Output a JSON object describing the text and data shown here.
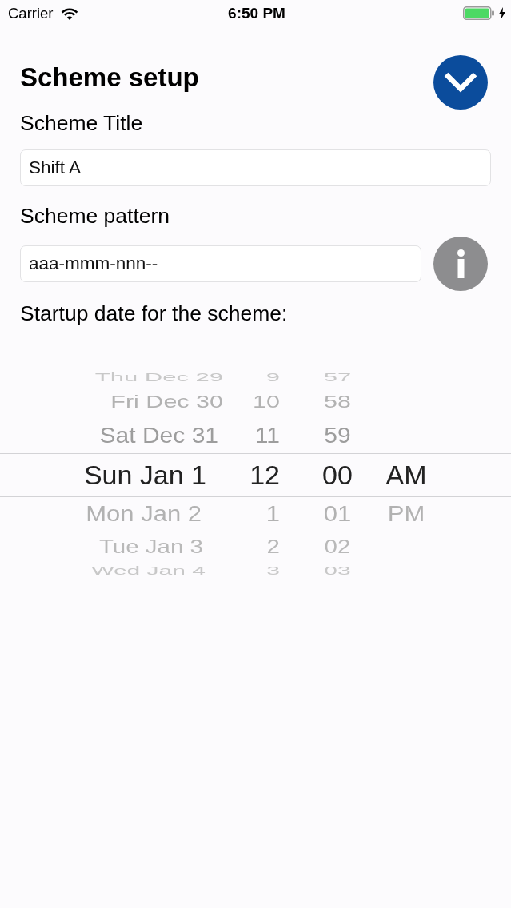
{
  "status_bar": {
    "carrier": "Carrier",
    "time": "6:50 PM",
    "charging": true
  },
  "header": {
    "title": "Scheme setup"
  },
  "fields": [
    {
      "kind": "plain",
      "label": "Scheme Title",
      "value": "Shift A"
    },
    {
      "kind": "info",
      "label": "Scheme pattern",
      "value": "aaa-mmm-nnn--"
    }
  ],
  "date_picker": {
    "label": "Startup date for the scheme:",
    "columns": [
      {
        "kind": "date",
        "items": [
          {
            "label": "Thu Dec 29",
            "selected": false
          },
          {
            "label": "Fri Dec 30",
            "selected": false
          },
          {
            "label": "Sat Dec 31",
            "selected": false
          },
          {
            "label": "Sun Jan 1",
            "selected": true
          },
          {
            "label": "Mon Jan 2",
            "selected": false
          },
          {
            "label": "Tue Jan 3",
            "selected": false
          },
          {
            "label": "Wed Jan 4",
            "selected": false
          }
        ]
      },
      {
        "kind": "hour",
        "items": [
          {
            "label": "9",
            "selected": false
          },
          {
            "label": "10",
            "selected": false
          },
          {
            "label": "11",
            "selected": false
          },
          {
            "label": "12",
            "selected": true
          },
          {
            "label": "1",
            "selected": false
          },
          {
            "label": "2",
            "selected": false
          },
          {
            "label": "3",
            "selected": false
          }
        ]
      },
      {
        "kind": "minute",
        "items": [
          {
            "label": "57",
            "selected": false
          },
          {
            "label": "58",
            "selected": false
          },
          {
            "label": "59",
            "selected": false
          },
          {
            "label": "00",
            "selected": true
          },
          {
            "label": "01",
            "selected": false
          },
          {
            "label": "02",
            "selected": false
          },
          {
            "label": "03",
            "selected": false
          }
        ]
      },
      {
        "kind": "period",
        "items": [
          {
            "label": "AM",
            "selected": true
          },
          {
            "label": "PM",
            "selected": false
          }
        ]
      }
    ]
  }
}
